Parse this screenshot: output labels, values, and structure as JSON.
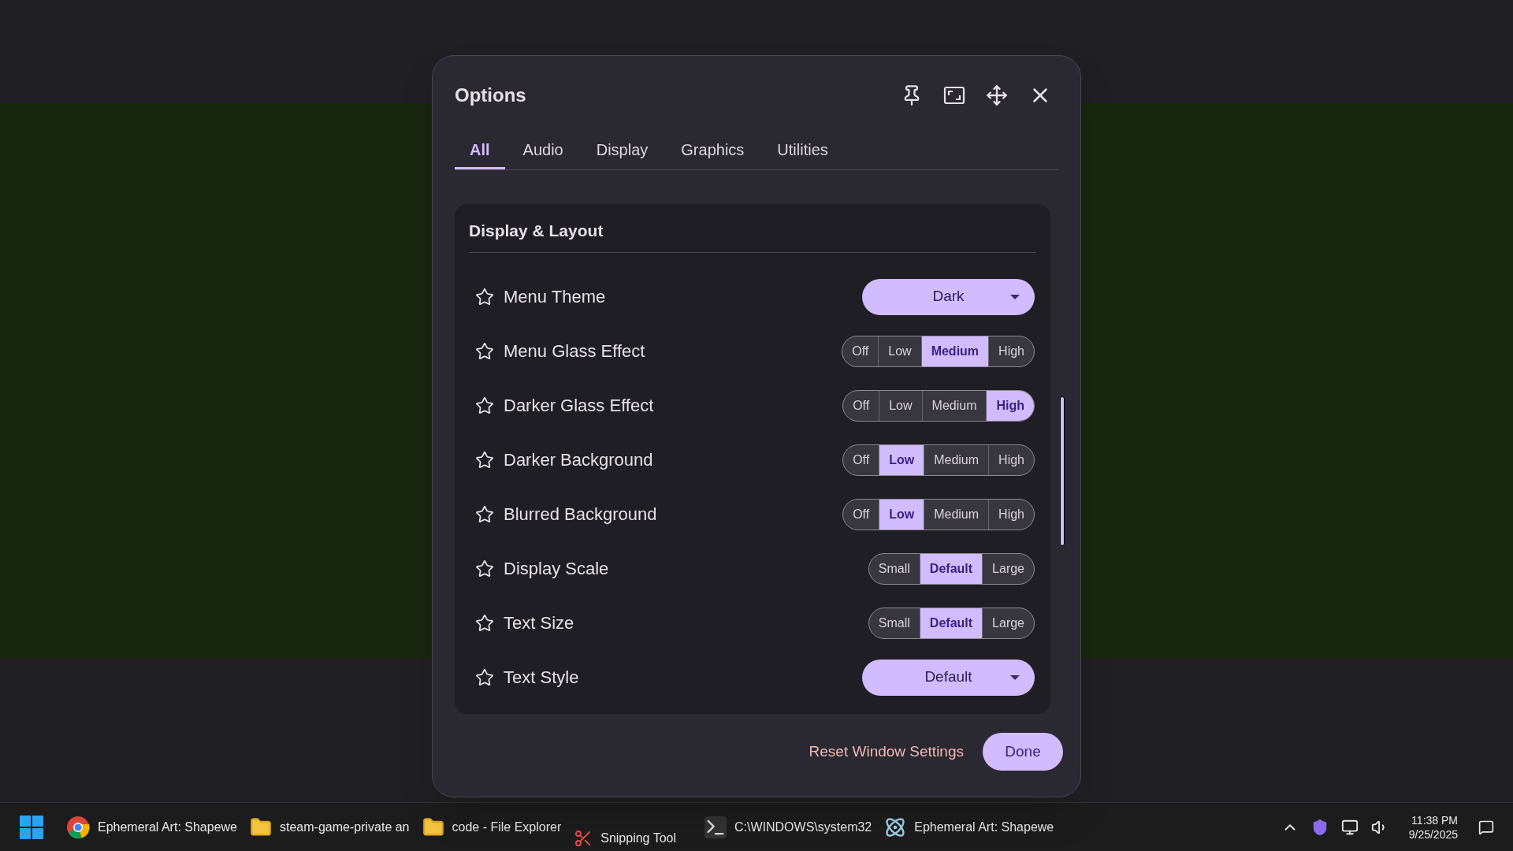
{
  "dialog": {
    "title": "Options",
    "tabs": [
      {
        "label": "All",
        "selected": true
      },
      {
        "label": "Audio",
        "selected": false
      },
      {
        "label": "Display",
        "selected": false
      },
      {
        "label": "Graphics",
        "selected": false
      },
      {
        "label": "Utilities",
        "selected": false
      }
    ],
    "section": {
      "title": "Display & Layout",
      "rows": [
        {
          "kind": "dropdown",
          "label": "Menu Theme",
          "starred": false,
          "value": "Dark"
        },
        {
          "kind": "segmented",
          "label": "Menu Glass Effect",
          "starred": false,
          "options": [
            {
              "label": "Off",
              "selected": false
            },
            {
              "label": "Low",
              "selected": false
            },
            {
              "label": "Medium",
              "selected": true
            },
            {
              "label": "High",
              "selected": false
            }
          ]
        },
        {
          "kind": "segmented",
          "label": "Darker Glass Effect",
          "starred": false,
          "options": [
            {
              "label": "Off",
              "selected": false
            },
            {
              "label": "Low",
              "selected": false
            },
            {
              "label": "Medium",
              "selected": false
            },
            {
              "label": "High",
              "selected": true
            }
          ]
        },
        {
          "kind": "segmented",
          "label": "Darker Background",
          "starred": false,
          "options": [
            {
              "label": "Off",
              "selected": false
            },
            {
              "label": "Low",
              "selected": true
            },
            {
              "label": "Medium",
              "selected": false
            },
            {
              "label": "High",
              "selected": false
            }
          ]
        },
        {
          "kind": "segmented",
          "label": "Blurred Background",
          "starred": false,
          "options": [
            {
              "label": "Off",
              "selected": false
            },
            {
              "label": "Low",
              "selected": true
            },
            {
              "label": "Medium",
              "selected": false
            },
            {
              "label": "High",
              "selected": false
            }
          ]
        },
        {
          "kind": "segmented",
          "label": "Display Scale",
          "starred": false,
          "options": [
            {
              "label": "Small",
              "selected": false
            },
            {
              "label": "Default",
              "selected": true
            },
            {
              "label": "Large",
              "selected": false
            }
          ]
        },
        {
          "kind": "segmented",
          "label": "Text Size",
          "starred": false,
          "options": [
            {
              "label": "Small",
              "selected": false
            },
            {
              "label": "Default",
              "selected": true
            },
            {
              "label": "Large",
              "selected": false
            }
          ]
        },
        {
          "kind": "dropdown",
          "label": "Text Style",
          "starred": false,
          "value": "Default"
        }
      ]
    },
    "footer": {
      "reset": "Reset Window Settings",
      "done": "Done"
    }
  },
  "taskbar": {
    "apps": [
      {
        "kind": "chrome",
        "label": "Ephemeral Art: Shapewe"
      },
      {
        "kind": "folder",
        "label": "steam-game-private an"
      },
      {
        "kind": "folder",
        "label": "code - File Explorer"
      },
      {
        "kind": "snip",
        "label": "Snipping Tool"
      },
      {
        "kind": "terminal",
        "label": "C:\\WINDOWS\\system32"
      },
      {
        "kind": "electron",
        "label": "Ephemeral Art: Shapewe"
      }
    ],
    "time": "11:38 PM",
    "date": "9/25/2025"
  }
}
